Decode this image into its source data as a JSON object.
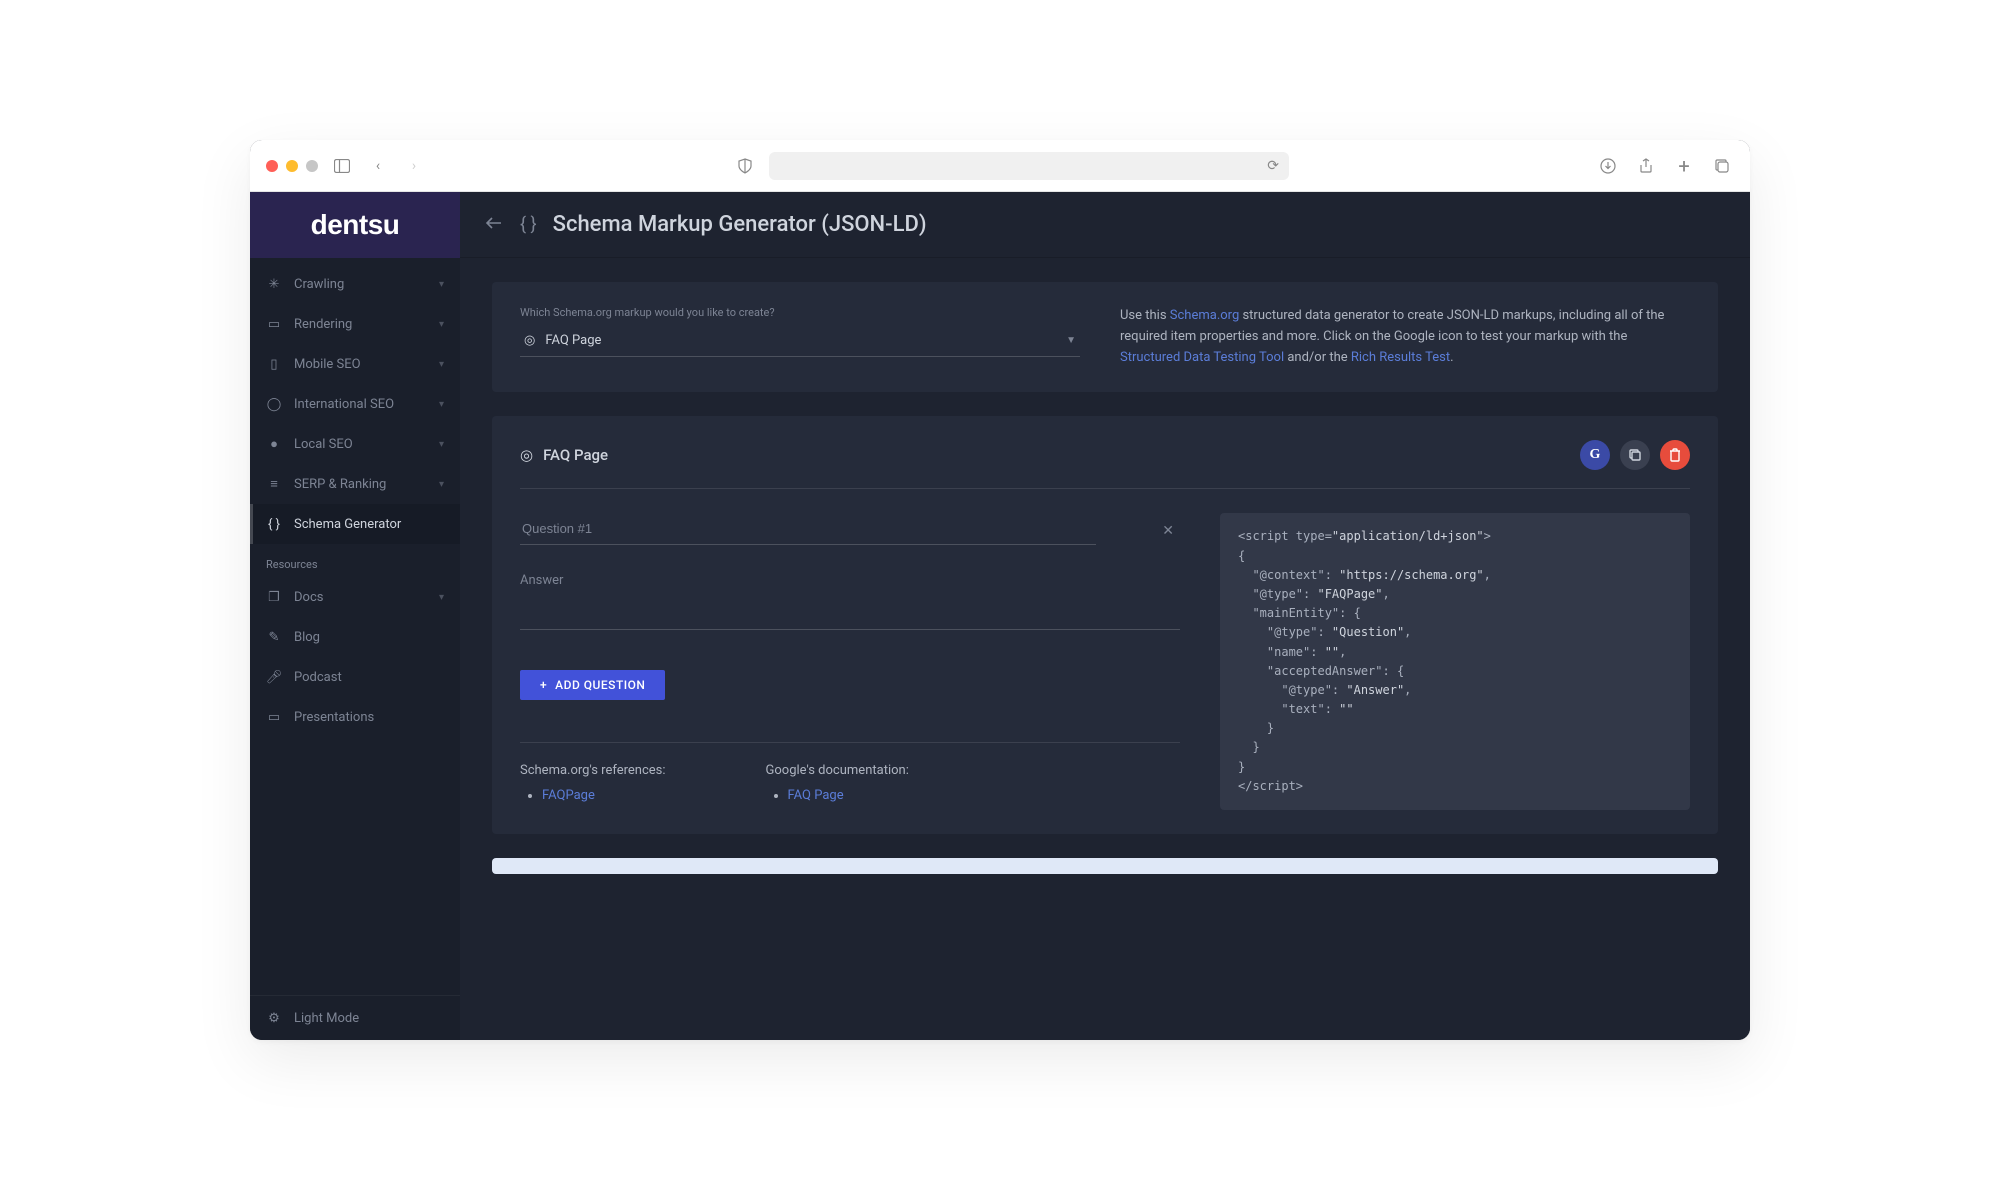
{
  "brand": "dentsu",
  "page_title": "Schema Markup Generator (JSON-LD)",
  "sidebar": {
    "items": [
      {
        "label": "Crawling",
        "icon": "bug-icon",
        "expandable": true
      },
      {
        "label": "Rendering",
        "icon": "browser-icon",
        "expandable": true
      },
      {
        "label": "Mobile SEO",
        "icon": "mobile-icon",
        "expandable": true
      },
      {
        "label": "International SEO",
        "icon": "globe-icon",
        "expandable": true
      },
      {
        "label": "Local SEO",
        "icon": "pin-icon",
        "expandable": true
      },
      {
        "label": "SERP & Ranking",
        "icon": "list-icon",
        "expandable": true
      },
      {
        "label": "Schema Generator",
        "icon": "braces-icon",
        "expandable": false,
        "active": true
      }
    ],
    "resources_label": "Resources",
    "resources": [
      {
        "label": "Docs",
        "icon": "docs-icon",
        "expandable": true
      },
      {
        "label": "Blog",
        "icon": "pencil-icon",
        "expandable": false
      },
      {
        "label": "Podcast",
        "icon": "mic-icon",
        "expandable": false
      },
      {
        "label": "Presentations",
        "icon": "screen-icon",
        "expandable": false
      }
    ],
    "footer": {
      "label": "Light Mode",
      "icon": "gear-icon"
    }
  },
  "top_panel": {
    "prompt": "Which Schema.org markup would you like to create?",
    "selected": "FAQ Page",
    "description": {
      "prefix": "Use this ",
      "link1": "Schema.org",
      "mid1": " structured data generator to create JSON-LD markups, including all of the required item properties and more. Click on the Google icon to test your markup with the ",
      "link2": "Structured Data Testing Tool",
      "mid2": " and/or the ",
      "link3": "Rich Results Test",
      "suffix": "."
    }
  },
  "main_panel": {
    "heading": "FAQ Page",
    "actions": {
      "google": "G",
      "copy_title": "Copy",
      "delete_title": "Delete"
    },
    "question_placeholder": "Question #1",
    "answer_label": "Answer",
    "add_button": "ADD QUESTION",
    "schema_refs_title": "Schema.org's references:",
    "schema_refs": [
      "FAQPage"
    ],
    "google_docs_title": "Google's documentation:",
    "google_docs": [
      "FAQ Page"
    ]
  },
  "code": {
    "l1a": "<script type=",
    "l1b": "\"application/ld+json\"",
    "l1c": ">",
    "l2": "{",
    "l3a": "  \"@context\": ",
    "l3b": "\"https://schema.org\"",
    "l3c": ",",
    "l4a": "  \"@type\": ",
    "l4b": "\"FAQPage\"",
    "l4c": ",",
    "l5": "  \"mainEntity\": {",
    "l6a": "    \"@type\": ",
    "l6b": "\"Question\"",
    "l6c": ",",
    "l7a": "    \"name\": ",
    "l7b": "\"\"",
    "l7c": ",",
    "l8": "    \"acceptedAnswer\": {",
    "l9a": "      \"@type\": ",
    "l9b": "\"Answer\"",
    "l9c": ",",
    "l10a": "      \"text\": ",
    "l10b": "\"\"",
    "l11": "    }",
    "l12": "  }",
    "l13": "}",
    "l14": "</scr",
    "l14b": "ipt>"
  }
}
